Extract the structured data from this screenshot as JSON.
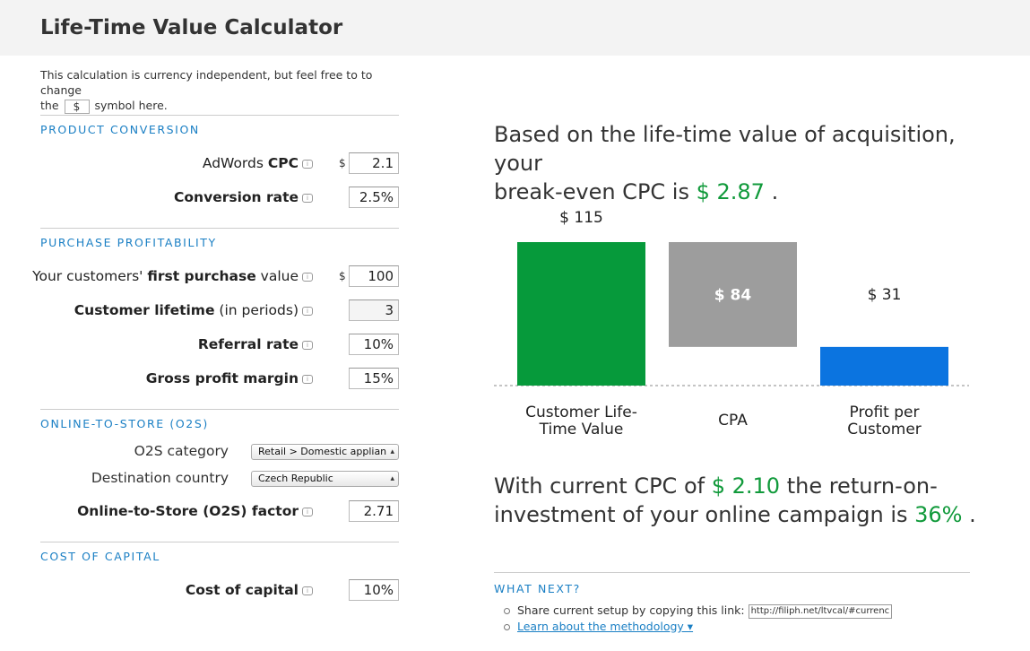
{
  "title": "Life-Time Value Calculator",
  "intro": {
    "text1": "This calculation is currency independent, but feel free to to change",
    "text2": "the",
    "currency_symbol": "$",
    "text3": "symbol here."
  },
  "sections": {
    "product_conversion": "PRODUCT CONVERSION",
    "purchase_profitability": "PURCHASE PROFITABILITY",
    "o2s": "ONLINE-TO-STORE (O2S)",
    "cost_of_capital": "COST OF CAPITAL"
  },
  "fields": {
    "cpc": {
      "pre": "AdWords ",
      "bold": "CPC",
      "post": "",
      "prefix": "$",
      "value": "2.1"
    },
    "conversion_rate": {
      "pre": "",
      "bold": "Conversion rate",
      "post": "",
      "value": "2.5%"
    },
    "first_purchase": {
      "pre": "Your customers' ",
      "bold": "first purchase",
      "post": " value",
      "prefix": "$",
      "value": "100"
    },
    "customer_lifetime": {
      "pre": "",
      "bold": "Customer lifetime",
      "post": " (in periods)",
      "value": "3"
    },
    "referral_rate": {
      "pre": "",
      "bold": "Referral rate",
      "post": "",
      "value": "10%"
    },
    "gross_margin": {
      "pre": "",
      "bold": "Gross profit margin",
      "post": "",
      "value": "15%"
    },
    "o2s_category": {
      "label": "O2S category",
      "value": "Retail > Domestic applian"
    },
    "destination_country": {
      "label": "Destination country",
      "value": "Czech Republic"
    },
    "o2s_factor": {
      "pre": "",
      "bold": "Online-to-Store (O2S) factor",
      "post": "",
      "value": "2.71"
    },
    "cost_of_capital": {
      "pre": "",
      "bold": "Cost of capital",
      "post": "",
      "value": "10%"
    }
  },
  "result": {
    "line1": "Based on the life-time value of acquisition, your",
    "line2_pre": "break-even CPC is ",
    "breakeven_cpc": "$ 2.87",
    "line2_post": " .",
    "roi_line1_pre": "With current CPC of ",
    "current_cpc": "$ 2.10",
    "roi_line1_post": "  the return-on-",
    "roi_line2_pre": "investment of your online campaign is  ",
    "roi": "36%",
    "roi_line2_post": " ."
  },
  "chart_data": {
    "type": "bar",
    "categories": [
      "Customer Life-Time Value",
      "CPA",
      "Profit per Customer"
    ],
    "values": [
      115,
      84,
      31
    ],
    "value_labels": [
      "$ 115",
      "$ 84",
      "$ 31"
    ],
    "category_lines": [
      [
        "Customer Life-",
        "Time Value"
      ],
      [
        "CPA"
      ],
      [
        "Profit per",
        "Customer"
      ]
    ],
    "colors": [
      "#069a3b",
      "#9d9d9d",
      "#0b74e0"
    ],
    "waterfall": true,
    "title": "",
    "xlabel": "",
    "ylabel": ""
  },
  "next": {
    "title": "WHAT NEXT?",
    "share_text": "Share current setup by copying this link:",
    "share_link": "http://filiph.net/ltvcal/#currenc",
    "methodology": "Learn about the methodology ▾"
  }
}
